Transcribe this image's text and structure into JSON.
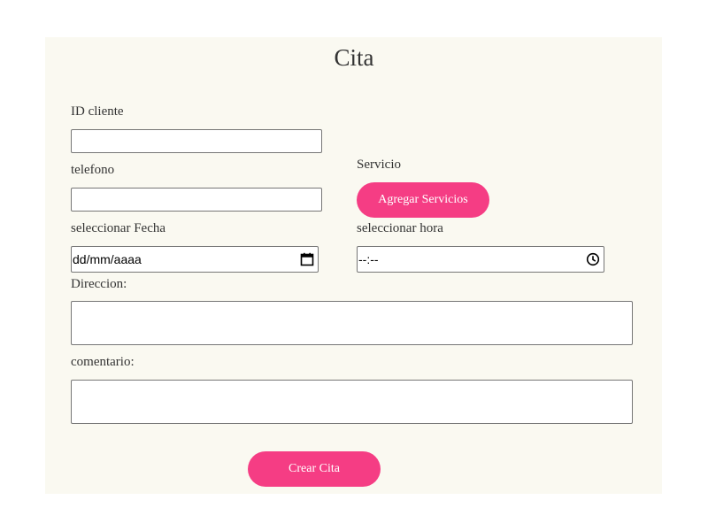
{
  "form": {
    "title": "Cita",
    "id_cliente_label": "ID cliente",
    "id_cliente_value": "",
    "telefono_label": "telefono",
    "telefono_value": "",
    "servicio_label": "Servicio",
    "agregar_servicios_label": "Agregar Servicios",
    "fecha_label": "seleccionar Fecha",
    "fecha_placeholder": "dd/mm/aaaa",
    "hora_label": "seleccionar hora",
    "hora_placeholder": "--:--",
    "direccion_label": "Direccion:",
    "direccion_value": "",
    "comentario_label": "comentario:",
    "comentario_value": "",
    "crear_cita_label": "Crear Cita"
  },
  "colors": {
    "accent": "#f53d84",
    "card_background": "#faf9f1"
  },
  "icons": {
    "date_picker": "calendar-icon",
    "time_picker": "clock-icon"
  }
}
